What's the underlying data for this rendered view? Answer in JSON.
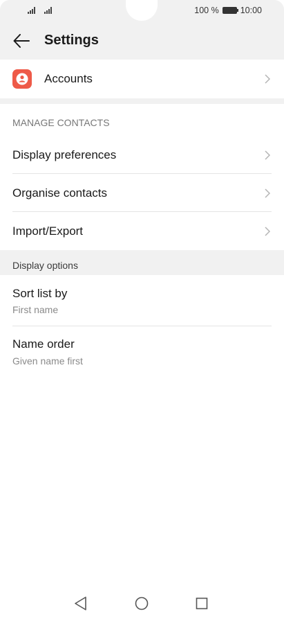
{
  "status_bar": {
    "battery_text": "100 %",
    "time": "10:00"
  },
  "header": {
    "title": "Settings"
  },
  "accounts": {
    "label": "Accounts"
  },
  "manage_contacts": {
    "section_label": "MANAGE CONTACTS",
    "items": [
      {
        "label": "Display preferences"
      },
      {
        "label": "Organise contacts"
      },
      {
        "label": "Import/Export"
      }
    ]
  },
  "display_options": {
    "section_label": "Display options",
    "items": [
      {
        "label": "Sort list by",
        "value": "First name"
      },
      {
        "label": "Name order",
        "value": "Given name first"
      }
    ]
  },
  "icons": {
    "back": "arrow-back-icon",
    "accounts": "person-icon",
    "chevron": "chevron-right-icon",
    "nav_back": "triangle-back-icon",
    "nav_home": "circle-home-icon",
    "nav_recents": "square-recents-icon"
  },
  "colors": {
    "accent": "#ee5a48",
    "background": "#f1f1f1"
  }
}
